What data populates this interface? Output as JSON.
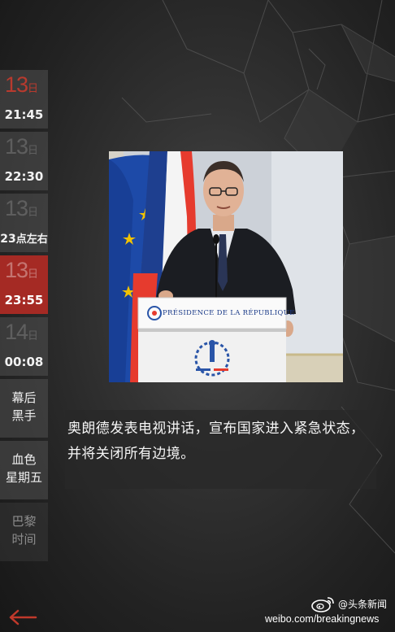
{
  "sidebar": {
    "items": [
      {
        "day": "13",
        "unit": "日",
        "time": "21:45"
      },
      {
        "day": "13",
        "unit": "日",
        "time": "22:30"
      },
      {
        "day": "13",
        "unit": "日",
        "time_num": "23",
        "time_suffix": "点左右"
      },
      {
        "day": "13",
        "unit": "日",
        "time": "23:55"
      },
      {
        "day": "14",
        "unit": "日",
        "time": "00:08"
      },
      {
        "line1": "幕后",
        "line2": "黑手"
      },
      {
        "line1": "血色",
        "line2": "星期五"
      },
      {
        "line1": "巴黎",
        "line2": "时间"
      }
    ],
    "back_icon": "back-arrow-icon"
  },
  "photo": {
    "podium_text": "PRÉSIDENCE DE LA RÉPUBLIQUE",
    "description": "French president speaking at a podium in front of EU and French flags"
  },
  "caption": {
    "line1": "奥朗德发表电视讲话，宣布国家进入紧急状态，",
    "line2": "并将关闭所有边境。"
  },
  "watermark": {
    "handle": "@头条新闻",
    "url": "weibo.com/breakingnews",
    "icon": "weibo-icon"
  },
  "colors": {
    "accent": "#a52a24",
    "first_day": "#b83a2e",
    "back_arrow": "#c0392b"
  }
}
